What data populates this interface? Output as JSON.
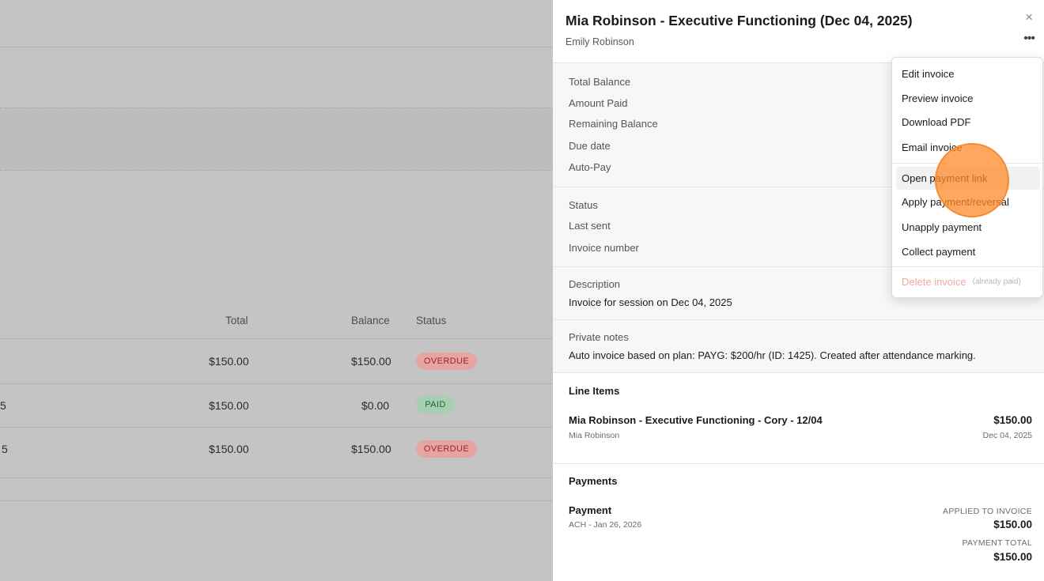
{
  "background_table": {
    "headers": {
      "total": "Total",
      "balance": "Balance",
      "status": "Status"
    },
    "rows": [
      {
        "lead": "",
        "total": "$150.00",
        "balance": "$150.00",
        "status": "OVERDUE"
      },
      {
        "lead": "5",
        "total": "$150.00",
        "balance": "$0.00",
        "status": "PAID"
      },
      {
        "lead": "5",
        "total": "$150.00",
        "balance": "$150.00",
        "status": "OVERDUE"
      }
    ]
  },
  "panel": {
    "title": "Mia Robinson - Executive Functioning (Dec 04, 2025)",
    "subtitle": "Emily Robinson",
    "close_icon": "×",
    "more_icon": "•••",
    "summary_labels": [
      "Total Balance",
      "Amount Paid",
      "Remaining Balance",
      "Due date",
      "Auto-Pay"
    ],
    "status_labels": [
      "Status",
      "Last sent",
      "Invoice number"
    ],
    "description_label": "Description",
    "description_value": "Invoice for session on Dec 04, 2025",
    "notes_label": "Private notes",
    "notes_value": "Auto invoice based on plan: PAYG: $200/hr (ID: 1425). Created after attendance marking.",
    "line_items_title": "Line Items",
    "line_item": {
      "name": "Mia Robinson - Executive Functioning - Cory - 12/04",
      "client": "Mia Robinson",
      "amount": "$150.00",
      "date": "Dec 04, 2025"
    },
    "payments_title": "Payments",
    "payment": {
      "name": "Payment",
      "method": "ACH - Jan 26, 2026",
      "applied_caption": "APPLIED TO INVOICE",
      "applied_amount": "$150.00",
      "total_caption": "PAYMENT TOTAL",
      "total_amount": "$150.00"
    }
  },
  "menu": {
    "items": [
      "Edit invoice",
      "Preview invoice",
      "Download PDF",
      "Email invoice",
      "Open payment link",
      "Apply payment/reversal",
      "Unapply payment",
      "Collect payment"
    ],
    "delete_label": "Delete invoice",
    "delete_note": "(already paid)",
    "highlighted": "Open payment link"
  },
  "colors": {
    "overdue_bg": "#e5a5a3",
    "paid_bg": "#a6cfb0",
    "danger_text": "#f2a7a3",
    "click_indicator": "#ff8928"
  }
}
